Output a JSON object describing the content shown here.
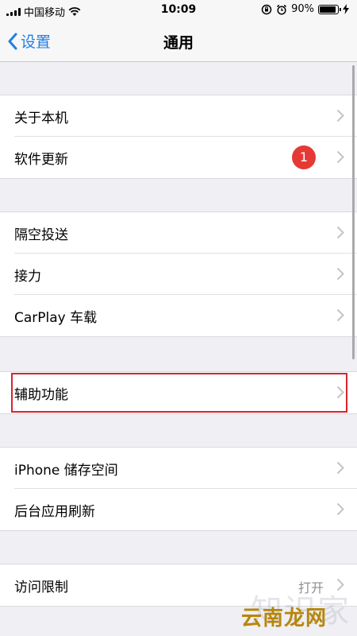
{
  "status": {
    "carrier": "中国移动",
    "time": "10:09",
    "battery_text": "90%",
    "battery_level": 0.9
  },
  "nav": {
    "back_label": "设置",
    "title": "通用"
  },
  "groups": {
    "g1": [
      {
        "label": "关于本机"
      },
      {
        "label": "软件更新",
        "badge": "1"
      }
    ],
    "g2": [
      {
        "label": "隔空投送"
      },
      {
        "label": "接力"
      },
      {
        "label": "CarPlay 车载"
      }
    ],
    "g3": [
      {
        "label": "辅助功能"
      }
    ],
    "g4": [
      {
        "label": "iPhone 储存空间"
      },
      {
        "label": "后台应用刷新"
      }
    ],
    "g5": [
      {
        "label": "访问限制",
        "detail": "打开"
      }
    ]
  },
  "watermark": {
    "bg_text": "知识家",
    "fg_text": "云南龙网"
  },
  "colors": {
    "accent": "#1f7fe8",
    "badge": "#e53935",
    "highlight": "#d8242c"
  }
}
